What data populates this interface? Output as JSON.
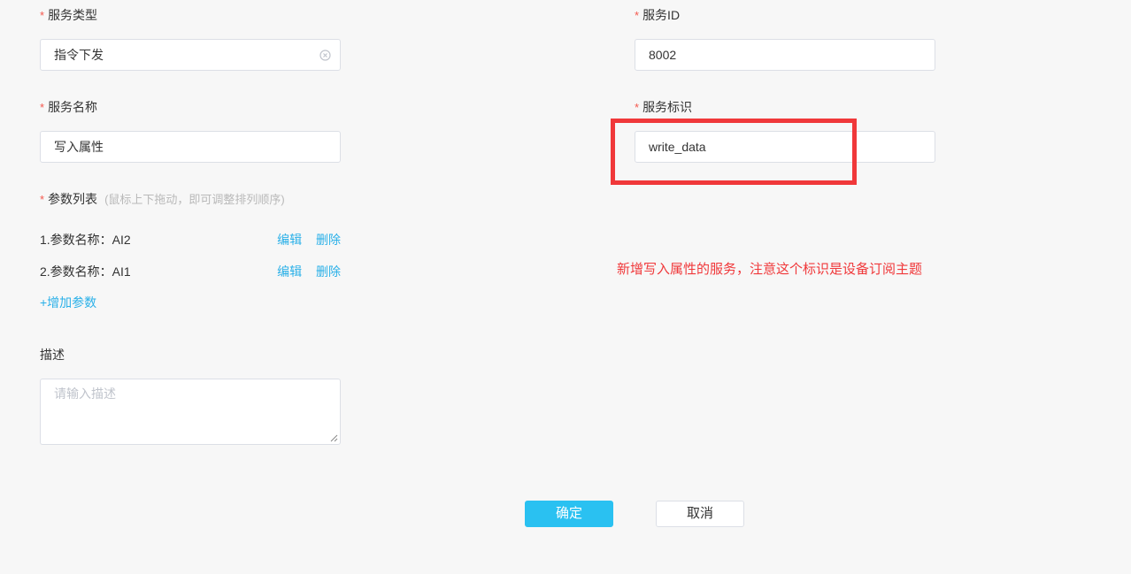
{
  "form": {
    "service_type": {
      "label": "服务类型",
      "value": "指令下发"
    },
    "service_id": {
      "label": "服务ID",
      "value": "8002"
    },
    "service_name": {
      "label": "服务名称",
      "value": "写入属性"
    },
    "service_identifier": {
      "label": "服务标识",
      "value": "write_data"
    },
    "params": {
      "label": "参数列表",
      "hint": "(鼠标上下拖动，即可调整排列顺序)",
      "items": [
        {
          "text": "1.参数名称：AI2",
          "edit": "编辑",
          "delete": "删除"
        },
        {
          "text": "2.参数名称：AI1",
          "edit": "编辑",
          "delete": "删除"
        }
      ],
      "add_label": "+增加参数"
    },
    "description": {
      "label": "描述",
      "placeholder": "请输入描述"
    },
    "required_mark": "*"
  },
  "annotation": {
    "text": "新增写入属性的服务，注意这个标识是设备订阅主题",
    "color": "#f0383a"
  },
  "buttons": {
    "confirm": "确定",
    "cancel": "取消"
  },
  "colors": {
    "accent": "#2ac1f1",
    "link": "#2ab0e8",
    "required": "#f5584e"
  }
}
